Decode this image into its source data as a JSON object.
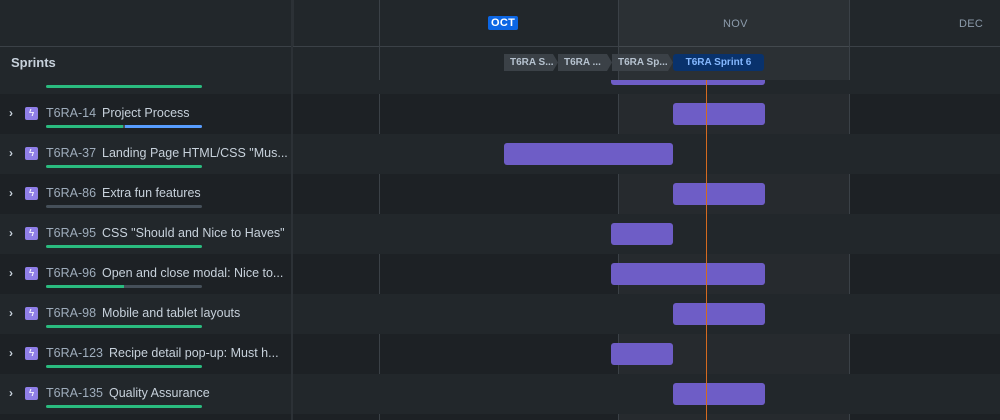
{
  "header": {
    "sprints_label": "Sprints",
    "months": [
      {
        "label": "OCT",
        "current": true
      },
      {
        "label": "NOV",
        "current": false
      },
      {
        "label": "DEC",
        "current": false
      }
    ],
    "sprints": [
      {
        "label": "T6RA S...",
        "active": false
      },
      {
        "label": "T6RA ...",
        "active": false
      },
      {
        "label": "T6RA Sp...",
        "active": false
      },
      {
        "label": "T6RA Sprint 6",
        "active": true
      }
    ]
  },
  "colors": {
    "epic": "#8f7ee7",
    "bar": "#6e5dc6",
    "done": "#2abb7f",
    "in_progress": "#579dff",
    "today": "#d46b1f"
  },
  "items": [
    {
      "key": "",
      "title": "",
      "progress": {
        "done": 1.0,
        "in_progress": 0
      }
    },
    {
      "key": "T6RA-14",
      "title": "Project Process",
      "progress": {
        "done": 0.5,
        "in_progress": 0.5
      }
    },
    {
      "key": "T6RA-37",
      "title": "Landing Page HTML/CSS \"Mus...",
      "progress": {
        "done": 1.0,
        "in_progress": 0
      }
    },
    {
      "key": "T6RA-86",
      "title": "Extra fun features",
      "progress": {
        "done": 0,
        "in_progress": 0
      }
    },
    {
      "key": "T6RA-95",
      "title": "CSS \"Should and Nice to Haves\"",
      "progress": {
        "done": 1.0,
        "in_progress": 0
      }
    },
    {
      "key": "T6RA-96",
      "title": "Open and close modal: Nice to...",
      "progress": {
        "done": 0.5,
        "in_progress": 0
      }
    },
    {
      "key": "T6RA-98",
      "title": "Mobile and tablet layouts",
      "progress": {
        "done": 1.0,
        "in_progress": 0
      }
    },
    {
      "key": "T6RA-123",
      "title": "Recipe detail pop-up: Must h...",
      "progress": {
        "done": 1.0,
        "in_progress": 0
      }
    },
    {
      "key": "T6RA-135",
      "title": "Quality Assurance",
      "progress": {
        "done": 1.0,
        "in_progress": 0
      }
    }
  ]
}
